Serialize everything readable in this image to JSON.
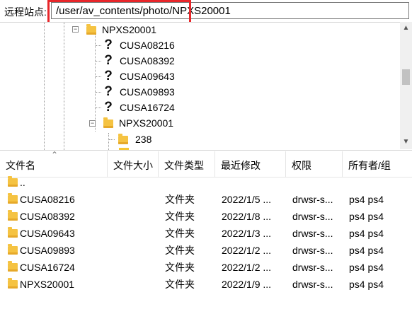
{
  "remote_site": {
    "label": "远程站点:",
    "path": "/user/av_contents/photo/NPXS20001"
  },
  "tree": {
    "root": "NPXS20001",
    "unknown_children": [
      "CUSA08216",
      "CUSA08392",
      "CUSA09643",
      "CUSA09893",
      "CUSA16724"
    ],
    "expanded_child": "NPXS20001",
    "grandchild": "238"
  },
  "file_list": {
    "columns": [
      "文件名",
      "文件大小",
      "文件类型",
      "最近修改",
      "权限",
      "所有者/组"
    ],
    "rows": [
      {
        "name": "..",
        "size": "",
        "type": "",
        "modified": "",
        "perms": "",
        "owner": ""
      },
      {
        "name": "CUSA08216",
        "size": "",
        "type": "文件夹",
        "modified": "2022/1/5 ...",
        "perms": "drwsr-s...",
        "owner": "ps4 ps4"
      },
      {
        "name": "CUSA08392",
        "size": "",
        "type": "文件夹",
        "modified": "2022/1/8 ...",
        "perms": "drwsr-s...",
        "owner": "ps4 ps4"
      },
      {
        "name": "CUSA09643",
        "size": "",
        "type": "文件夹",
        "modified": "2022/1/3 ...",
        "perms": "drwsr-s...",
        "owner": "ps4 ps4"
      },
      {
        "name": "CUSA09893",
        "size": "",
        "type": "文件夹",
        "modified": "2022/1/2 ...",
        "perms": "drwsr-s...",
        "owner": "ps4 ps4"
      },
      {
        "name": "CUSA16724",
        "size": "",
        "type": "文件夹",
        "modified": "2022/1/2 ...",
        "perms": "drwsr-s...",
        "owner": "ps4 ps4"
      },
      {
        "name": "NPXS20001",
        "size": "",
        "type": "文件夹",
        "modified": "2022/1/9 ...",
        "perms": "drwsr-s...",
        "owner": "ps4 ps4"
      }
    ]
  },
  "colors": {
    "highlight_border": "#e8262a",
    "folder": "#f5c342"
  },
  "icons": [
    "folder-icon",
    "question-icon",
    "expand-icon",
    "collapse-icon",
    "chevron-up-icon",
    "chevron-down-icon",
    "sort-up-icon"
  ]
}
